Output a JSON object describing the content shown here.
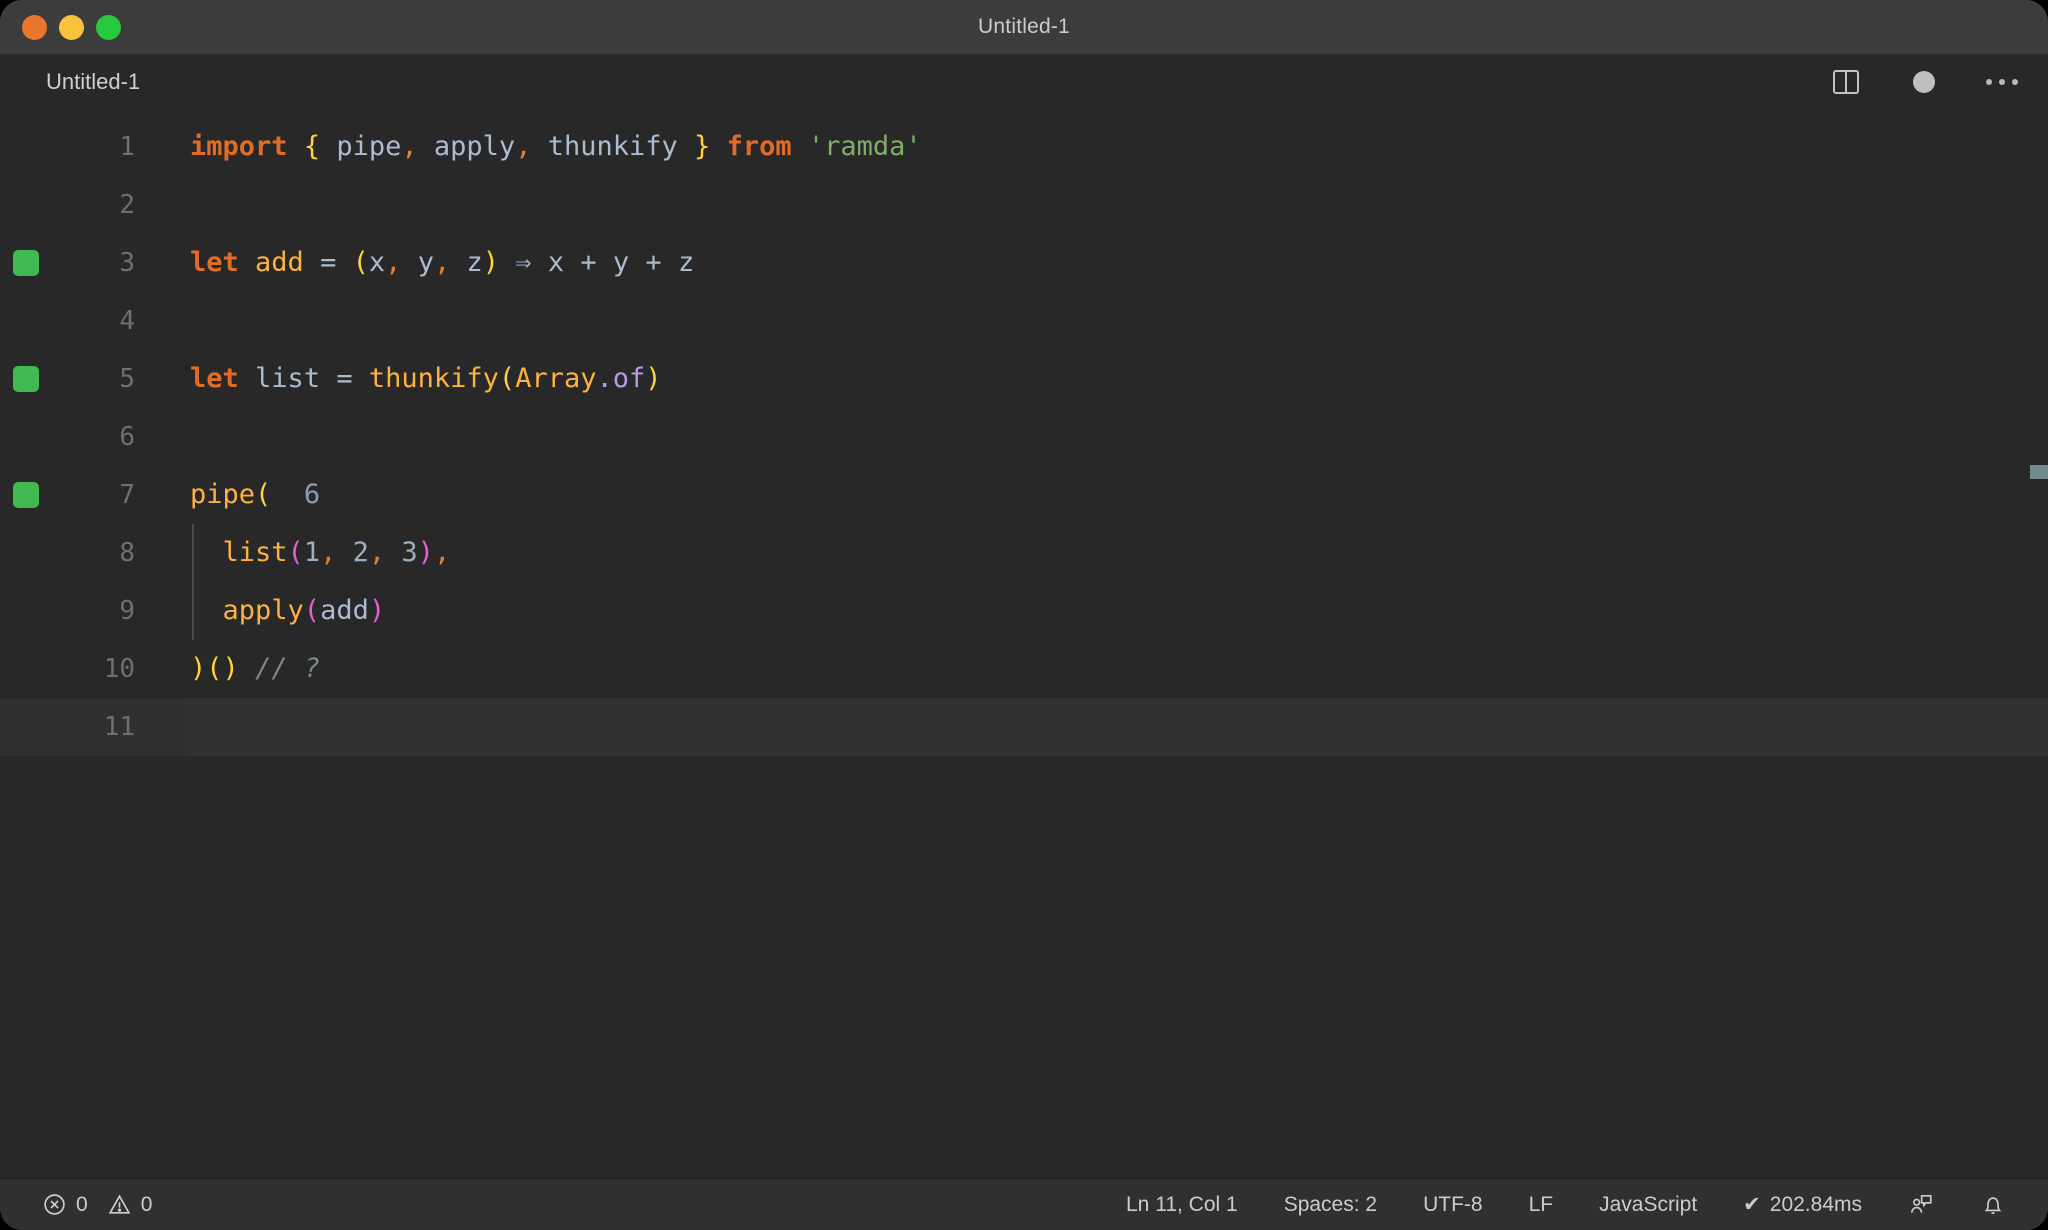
{
  "window": {
    "title": "Untitled-1",
    "traffic_lights": [
      "close-red",
      "minimize-yellow",
      "maximize-green"
    ]
  },
  "tabbar": {
    "tabs": [
      {
        "label": "Untitled-1",
        "active": true,
        "dirty": true
      }
    ],
    "actions": [
      {
        "name": "split-editor-icon",
        "label": "Split Editor"
      },
      {
        "name": "unsaved-dot-icon",
        "label": "Unsaved changes"
      },
      {
        "name": "more-actions-icon",
        "label": "More Actions..."
      }
    ]
  },
  "editor": {
    "language": "JavaScript",
    "lines": [
      {
        "n": "1",
        "gutter": false,
        "indent": false,
        "current": false
      },
      {
        "n": "2",
        "gutter": false,
        "indent": false,
        "current": false
      },
      {
        "n": "3",
        "gutter": true,
        "indent": false,
        "current": false
      },
      {
        "n": "4",
        "gutter": false,
        "indent": false,
        "current": false
      },
      {
        "n": "5",
        "gutter": true,
        "indent": false,
        "current": false
      },
      {
        "n": "6",
        "gutter": false,
        "indent": false,
        "current": false
      },
      {
        "n": "7",
        "gutter": true,
        "indent": false,
        "current": false
      },
      {
        "n": "8",
        "gutter": false,
        "indent": true,
        "current": false
      },
      {
        "n": "9",
        "gutter": false,
        "indent": true,
        "current": false
      },
      {
        "n": "10",
        "gutter": false,
        "indent": false,
        "current": false
      },
      {
        "n": "11",
        "gutter": false,
        "indent": false,
        "current": true
      }
    ],
    "source": {
      "l1": "import { pipe, apply, thunkify } from 'ramda'",
      "l2": "",
      "l3": "let add = (x, y, z) => x + y + z",
      "l4": "",
      "l5": "let list = thunkify(Array.of)",
      "l6": "",
      "l7": "pipe(",
      "l8": "  list(1, 2, 3),",
      "l9": "  apply(add)",
      "l10": ")() // ?",
      "l11": ""
    },
    "tokens": {
      "import": "import",
      "brace_open": "{",
      "pipe": "pipe",
      "apply": "apply",
      "thunkify": "thunkify",
      "brace_close": "}",
      "from": "from",
      "ramda": "'ramda'",
      "let": "let",
      "add": "add",
      "eq": "=",
      "x": "x",
      "y": "y",
      "z": "z",
      "arrow": "⇒",
      "plus": "+",
      "list": "list",
      "array": "Array",
      "dot_of": ".of",
      "one": "1",
      "two": "2",
      "three": "3",
      "comma": ",",
      "paren_open": "(",
      "paren_close": ")",
      "comment": "// ?"
    },
    "inline_hints": [
      {
        "line": "7",
        "value": "6"
      }
    ]
  },
  "statusbar": {
    "errors_icon": "error-circle-icon",
    "errors_count": "0",
    "warnings_icon": "warning-triangle-icon",
    "warnings_count": "0",
    "cursor_position": "Ln 11, Col 1",
    "indentation": "Spaces: 2",
    "encoding": "UTF-8",
    "eol": "LF",
    "language_mode": "JavaScript",
    "quokka_check": "✔",
    "quokka_time": "202.84ms",
    "feedback_icon": "feedback-person-icon",
    "bell_icon": "notifications-bell-icon"
  },
  "colors": {
    "background": "#282828",
    "titlebar": "#3c3c3c",
    "statusbar": "#303030",
    "gutter_ok": "#3fb950",
    "keyword": "#e06c28",
    "function": "#fcb242",
    "string": "#7ead6a",
    "identifier": "#abbbd0",
    "bracket_yellow": "#ffd33d",
    "bracket_magenta": "#e45fd8",
    "property": "#b999e8",
    "comment": "#7d8a7d",
    "linenumber": "#6f6f6f"
  }
}
